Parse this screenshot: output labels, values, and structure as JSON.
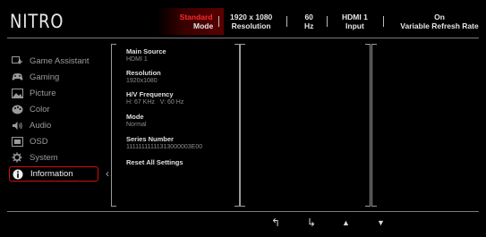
{
  "brand": {
    "logo_text": "NITRO"
  },
  "status_bar": {
    "items": [
      {
        "value": "Standard",
        "key": "Mode",
        "highlight": true
      },
      {
        "value": "1920 x 1080",
        "key": "Resolution",
        "highlight": false
      },
      {
        "value": "60",
        "key": "Hz",
        "highlight": false
      },
      {
        "value": "HDMI 1",
        "key": "Input",
        "highlight": false
      },
      {
        "value": "On",
        "key": "Variable Refresh Rate",
        "highlight": false
      }
    ]
  },
  "sidebar": {
    "items": [
      {
        "label": "Game Assistant",
        "icon": "game-assistant-icon"
      },
      {
        "label": "Gaming",
        "icon": "gamepad-icon"
      },
      {
        "label": "Picture",
        "icon": "picture-icon"
      },
      {
        "label": "Color",
        "icon": "palette-icon"
      },
      {
        "label": "Audio",
        "icon": "speaker-icon"
      },
      {
        "label": "OSD",
        "icon": "osd-icon"
      },
      {
        "label": "System",
        "icon": "gear-icon"
      },
      {
        "label": "Information",
        "icon": "info-icon",
        "active": true
      }
    ]
  },
  "info_panel": {
    "rows": [
      {
        "label": "Main Source",
        "value": "HDMI 1"
      },
      {
        "label": "Resolution",
        "value": "1920x1080"
      },
      {
        "label": "H/V Frequency",
        "value": "H: 67 KHz   V: 60 Hz"
      },
      {
        "label": "Mode",
        "value": "Normal"
      },
      {
        "label": "Series Number",
        "value": "11111111111313000003E00"
      },
      {
        "label": "Reset All Settings",
        "value": ""
      }
    ]
  },
  "nav_buttons": [
    {
      "name": "back-icon",
      "glyph": "↰"
    },
    {
      "name": "enter-icon",
      "glyph": "↳"
    },
    {
      "name": "up-icon",
      "glyph": "▲"
    },
    {
      "name": "down-icon",
      "glyph": "▼"
    }
  ],
  "colors": {
    "accent": "#d01010",
    "background": "#000000"
  }
}
